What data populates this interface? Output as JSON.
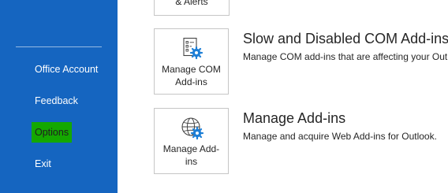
{
  "colors": {
    "sidebar_bg": "#1565c0",
    "highlight_bg": "#14a800",
    "gear_blue": "#1e7fd6"
  },
  "sidebar": {
    "items": [
      {
        "label": "Office Account"
      },
      {
        "label": "Feedback"
      },
      {
        "label": "Options"
      },
      {
        "label": "Exit"
      }
    ]
  },
  "main": {
    "partial_tile": {
      "label": "& Alerts"
    },
    "com_addins": {
      "tile_label_line1": "Manage COM",
      "tile_label_line2": "Add-ins",
      "title": "Slow and Disabled COM Add-ins",
      "description": "Manage COM add-ins that are affecting your Outlook experience.",
      "icon": "document-gear-icon"
    },
    "web_addins": {
      "tile_label_line1": "Manage Add-",
      "tile_label_line2": "ins",
      "title": "Manage Add-ins",
      "description": "Manage and acquire Web Add-ins for Outlook.",
      "icon": "globe-gear-icon"
    }
  }
}
